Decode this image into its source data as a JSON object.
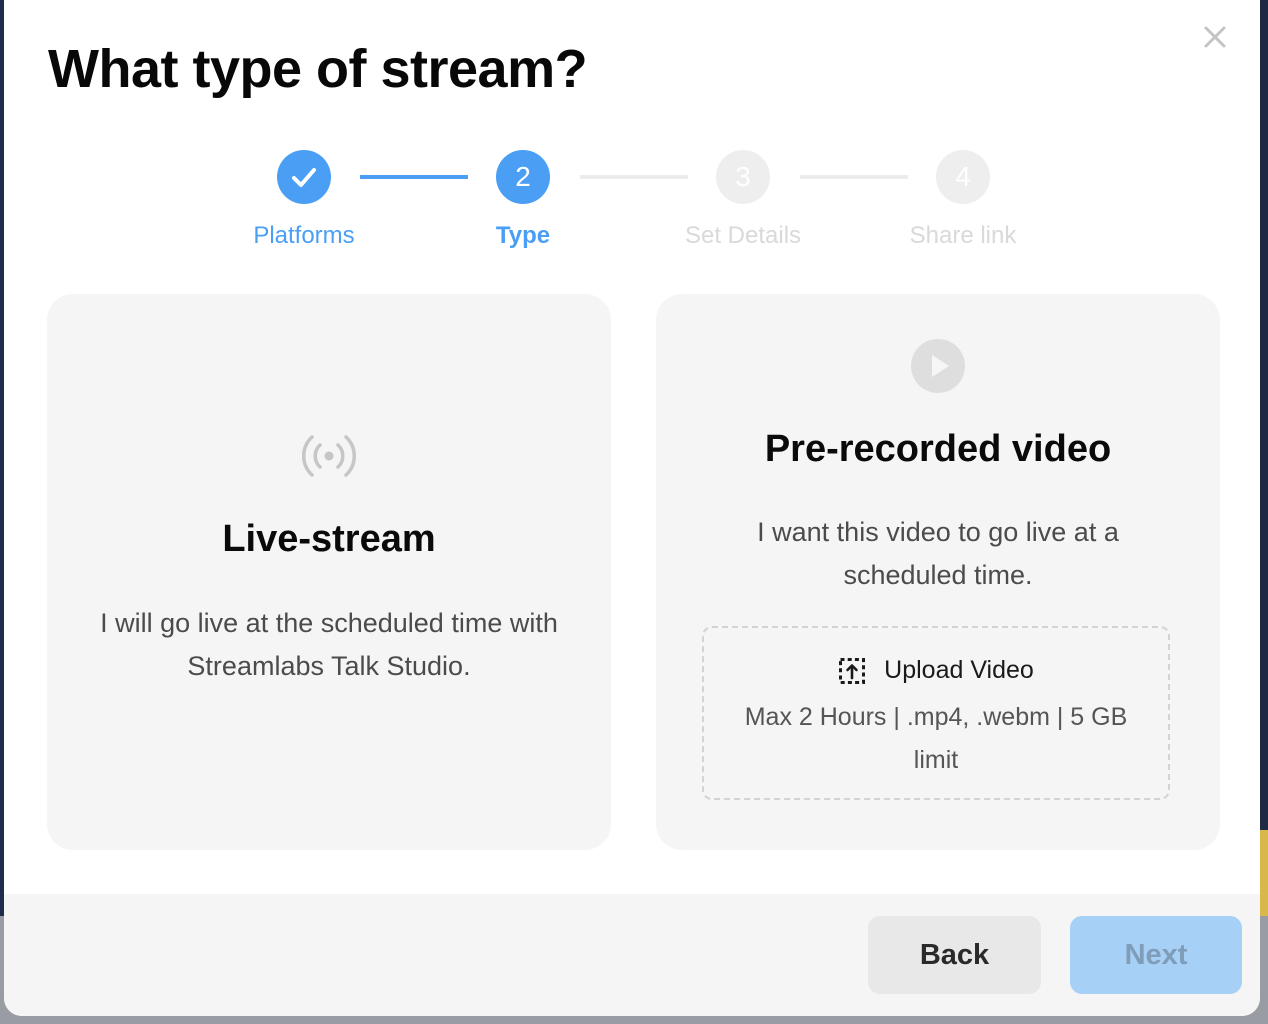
{
  "modal": {
    "title": "What type of stream?"
  },
  "stepper": {
    "steps": [
      {
        "number": "1",
        "label": "Platforms",
        "state": "done"
      },
      {
        "number": "2",
        "label": "Type",
        "state": "active"
      },
      {
        "number": "3",
        "label": "Set Details",
        "state": "pending"
      },
      {
        "number": "4",
        "label": "Share link",
        "state": "pending"
      }
    ]
  },
  "options": {
    "live": {
      "icon": "broadcast-icon",
      "title": "Live-stream",
      "description": "I will go live at the scheduled time with Streamlabs Talk Studio."
    },
    "prerecorded": {
      "icon": "play-circle-icon",
      "title": "Pre-recorded video",
      "description": "I want this video to go live at a scheduled time.",
      "upload": {
        "icon": "upload-icon",
        "label": "Upload Video",
        "limits": "Max 2 Hours | .mp4, .webm | 5 GB limit"
      }
    }
  },
  "footer": {
    "back_label": "Back",
    "next_label": "Next"
  },
  "colors": {
    "accent": "#4a9ff5",
    "next_disabled": "#a7d0f7",
    "card_bg": "#f5f5f5"
  }
}
